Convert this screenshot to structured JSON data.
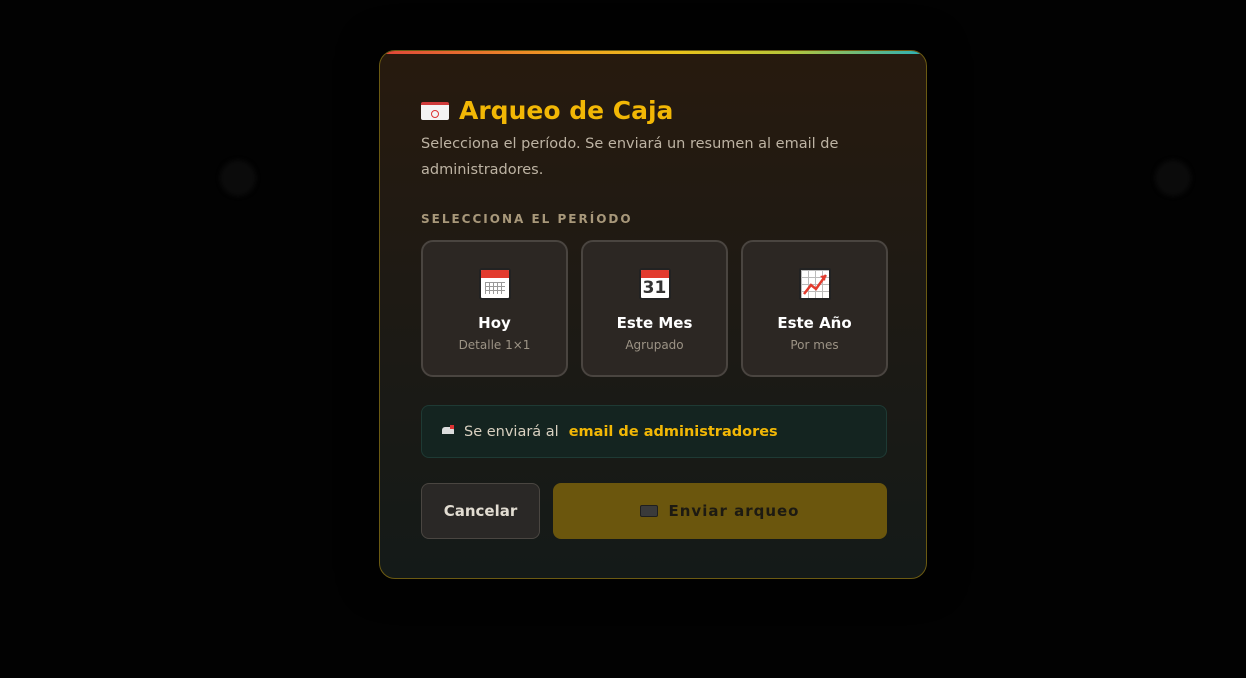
{
  "modal": {
    "title": "Arqueo de Caja",
    "subtitle": "Selecciona el período. Se enviará un resumen al email de administradores.",
    "section_label": "SELECCIONA EL PERÍODO",
    "periods": [
      {
        "name": "Hoy",
        "desc": "Detalle 1×1",
        "icon": "calendar-tear-off-icon"
      },
      {
        "name": "Este Mes",
        "desc": "Agrupado",
        "icon": "calendar-31-icon",
        "icon_text": "31"
      },
      {
        "name": "Este Año",
        "desc": "Por mes",
        "icon": "chart-increasing-icon"
      }
    ],
    "info": {
      "prefix": "Se enviará al",
      "highlight": "email de administradores"
    },
    "buttons": {
      "cancel": "Cancelar",
      "send": "Enviar arqueo"
    }
  },
  "colors": {
    "accent": "#f2b705",
    "send_button_bg": "#6b560d",
    "info_bg": "#142420"
  }
}
